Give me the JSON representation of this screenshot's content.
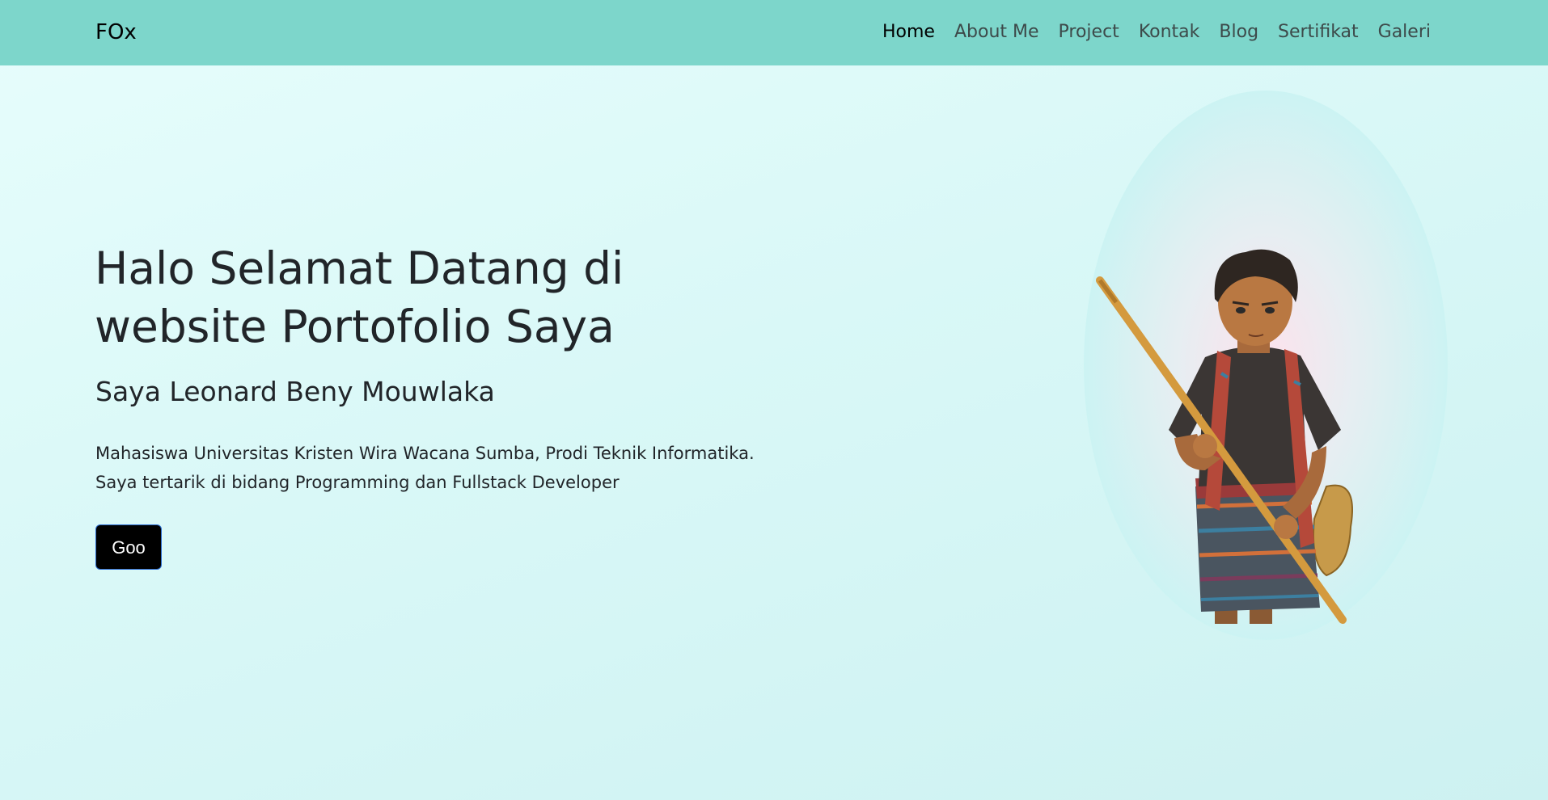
{
  "navbar": {
    "brand": "FOx",
    "links": [
      {
        "label": "Home",
        "active": true
      },
      {
        "label": "About Me"
      },
      {
        "label": "Project"
      },
      {
        "label": "Kontak"
      },
      {
        "label": "Blog"
      },
      {
        "label": "Sertifikat"
      },
      {
        "label": "Galeri"
      }
    ]
  },
  "hero": {
    "title_line1": "Halo Selamat Datang di",
    "title_line2": "website Portofolio Saya",
    "subtitle": "Saya Leonard Beny Mouwlaka",
    "desc_line1": "Mahasiswa Universitas Kristen Wira Wacana Sumba, Prodi Teknik Informatika.",
    "desc_line2": "Saya tertarik di bidang Programming dan Fullstack Developer",
    "cta_label": "Goo"
  },
  "colors": {
    "navbar_bg": "#7dd6cb",
    "page_bg": "#d9f8f7",
    "button_bg": "#000000",
    "button_border": "#2b6cd0"
  }
}
